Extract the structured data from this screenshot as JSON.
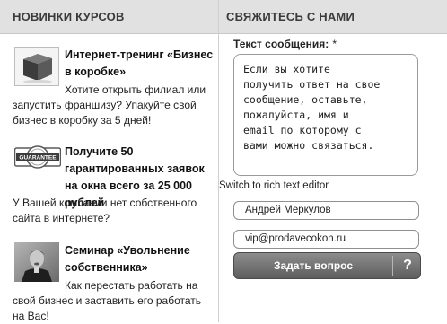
{
  "left_panel": {
    "heading": "НОВИНКИ КУРСОВ",
    "items": [
      {
        "icon": "box-icon",
        "title": "Интернет-тренинг «Бизнес в коробке»",
        "desc_first": "Хотите открыть филиал или",
        "desc_rest": "запустить франшизу? Упакуйте свой бизнес в коробку за 5 дней!"
      },
      {
        "icon": "guarantee-stamp-icon",
        "title": "Получите 50 гарантированных заявок на окна всего за 25 000 рублей",
        "desc": "У Вашей компании нет собственного сайта в интернете?",
        "stamp_text": "GUARANTEE"
      },
      {
        "icon": "speaker-photo",
        "title": "Семинар «Увольнение собственника»",
        "desc_first": "Как перестать работать на",
        "desc_rest": "свой бизнес и заставить его работать на Вас!"
      }
    ]
  },
  "right_panel": {
    "heading": "СВЯЖИТЕСЬ С НАМИ",
    "message_label": "Текст сообщения:",
    "required_mark": "*",
    "message_text": "Если вы хотите\nполучить ответ на свое\nсообщение, оставьте,\nпожалуйста, имя и\nemail по которому с\nвами можно связаться.",
    "rich_text_link": "Switch to rich text editor",
    "name_value": "Андрей Меркулов",
    "email_value": "vip@prodavecokon.ru",
    "submit_label": "Задать вопрос",
    "help_label": "?"
  },
  "colors": {
    "header_bg": "#e1e1e1",
    "button_dark": "#5e5e5e",
    "button_light": "#8c8c8c"
  }
}
